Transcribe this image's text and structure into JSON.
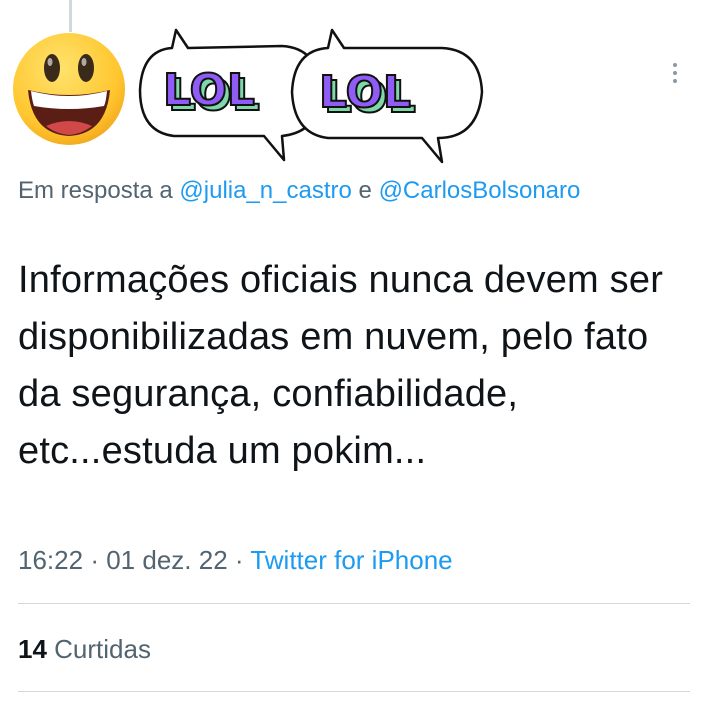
{
  "tweet": {
    "reply_prefix": "Em resposta a",
    "reply_mention_1": "@julia_n_castro",
    "reply_joiner": "e",
    "reply_mention_2": "@CarlosBolsonaro",
    "text": "Informações oficiais nunca devem ser disponibilizadas em nuvem, pelo fato da segurança, confiabilidade, etc...estuda um pokim...",
    "time": "16:22",
    "separator": "·",
    "date": "01 dez. 22",
    "source": "Twitter for iPhone"
  },
  "stats": {
    "likes_count": "14",
    "likes_label": "Curtidas"
  },
  "sticker": {
    "bubble_1_text": "LOL",
    "bubble_2_text": "LOL"
  },
  "icons": {
    "avatar": "grinning-face-emoji",
    "more": "more-vertical-icon"
  },
  "colors": {
    "link": "#1d9bf0",
    "secondary_text": "#536471",
    "primary_text": "#0f1419",
    "lol_fill": "#8f5cf5",
    "lol_shadow": "#7fd8a8",
    "emoji_yellow": "#ffc93c"
  }
}
